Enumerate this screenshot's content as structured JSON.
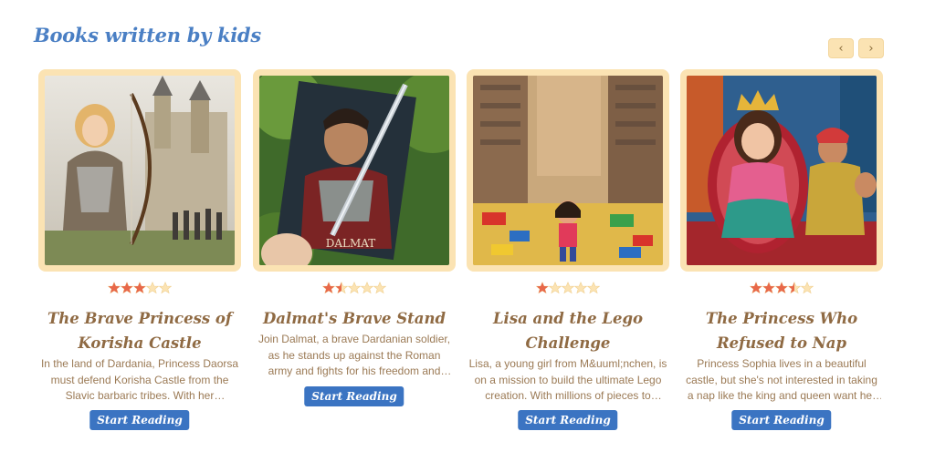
{
  "section": {
    "title": "Books written by kids"
  },
  "nav": {
    "prev_label": "‹",
    "next_label": "›"
  },
  "books": [
    {
      "title": "The Brave Princess of Korisha Castle",
      "description": "In the land of Dardania, Princess Daorsa must defend Korisha Castle from the Slavic barbaric tribes. With her exceptional…",
      "rating": 3,
      "cta": "Start Reading",
      "cover_icon": "princess-archer-castle"
    },
    {
      "title": "Dalmat's Brave Stand",
      "description": "Join Dalmat, a brave Dardanian soldier, as he stands up against the Roman army and fights for his freedom and homeland.",
      "rating": 1.5,
      "cta": "Start Reading",
      "cover_icon": "soldier-with-book",
      "cover_text": "DALMAT"
    },
    {
      "title": "Lisa and the Lego Challenge",
      "description": "Lisa, a young girl from M&uuml;nchen, is on a mission to build the ultimate Lego creation. With millions of pieces to combi…",
      "rating": 1,
      "cta": "Start Reading",
      "cover_icon": "girl-lego-city"
    },
    {
      "title": "The Princess Who Refused to Nap",
      "description": "Princess Sophia lives in a beautiful castle, but she's not interested in taking a nap like the king and queen want her to. She'd…",
      "rating": 3.5,
      "cta": "Start Reading",
      "cover_icon": "princess-on-throne"
    }
  ],
  "colors": {
    "accent": "#3b74c2",
    "heading": "#4a7fc4",
    "card_frame": "#fbe3b3",
    "title_text": "#8f6a43",
    "star_filled": "#e8684a",
    "star_empty": "#fbe3b3"
  }
}
